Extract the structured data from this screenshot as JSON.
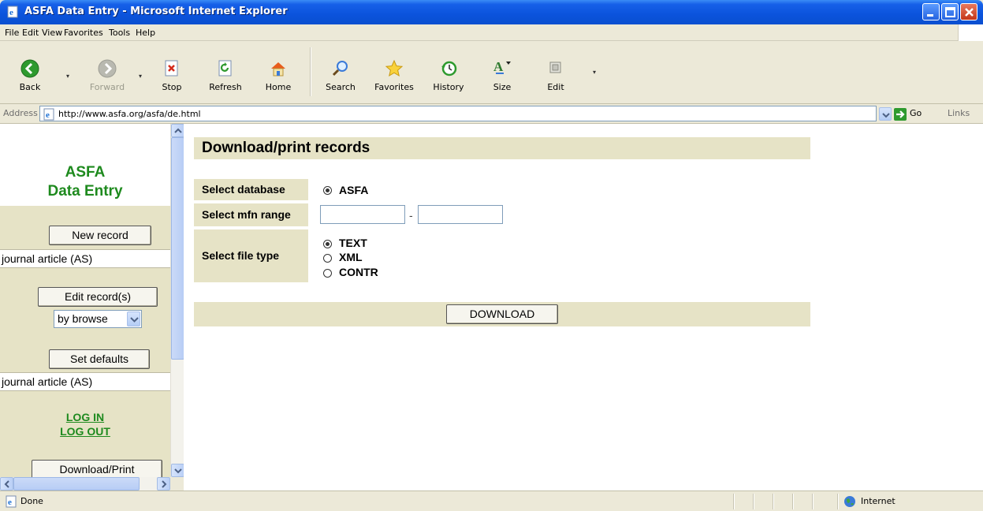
{
  "window": {
    "title": "ASFA Data Entry - Microsoft Internet Explorer"
  },
  "menubar": {
    "items": [
      {
        "label": "File",
        "mnemonic": "F",
        "rest": "ile"
      },
      {
        "label": "Edit",
        "mnemonic": "E",
        "rest": "dit"
      },
      {
        "label": "View",
        "mnemonic": "V",
        "rest": "iew"
      },
      {
        "label": "Favorites",
        "mnemonic": "",
        "rest": "Favorites",
        "mnemonic_pos": "a"
      },
      {
        "label": "Tools",
        "mnemonic": "T",
        "rest": "ools"
      },
      {
        "label": "Help",
        "mnemonic": "H",
        "rest": "elp"
      }
    ]
  },
  "toolbar": {
    "back": "Back",
    "forward": "Forward",
    "stop": "Stop",
    "refresh": "Refresh",
    "home": "Home",
    "search": "Search",
    "favorites": "Favorites",
    "history": "History",
    "size": "Size",
    "edit": "Edit"
  },
  "addressbar": {
    "label": "Address",
    "url": "http://www.asfa.org/asfa/de.html",
    "go": "Go",
    "links": "Links"
  },
  "leftframe": {
    "logo_line1": "ASFA",
    "logo_line2": "Data Entry",
    "new_record": "New record",
    "new_record_type": "journal article (AS)",
    "edit_records": "Edit record(s)",
    "edit_mode": "by browse",
    "set_defaults": "Set defaults",
    "defaults_type": "journal article (AS)",
    "log_in": "LOG IN",
    "log_out": "LOG OUT",
    "download_print": "Download/Print"
  },
  "main": {
    "heading": "Download/print records",
    "select_database_label": "Select database",
    "database_option": "ASFA",
    "select_mfn_label": "Select mfn range",
    "mfn_from": "",
    "mfn_to": "",
    "mfn_separator": "-",
    "select_file_type_label": "Select file type",
    "file_types": [
      "TEXT",
      "XML",
      "CONTR"
    ],
    "selected_file_type": "TEXT",
    "download_button": "DOWNLOAD"
  },
  "statusbar": {
    "text": "Done",
    "zone": "Internet"
  },
  "colors": {
    "panel_bg": "#e6e3c6",
    "logo_green": "#1e8a1e",
    "titlebar_blue": "#0b53dc"
  }
}
